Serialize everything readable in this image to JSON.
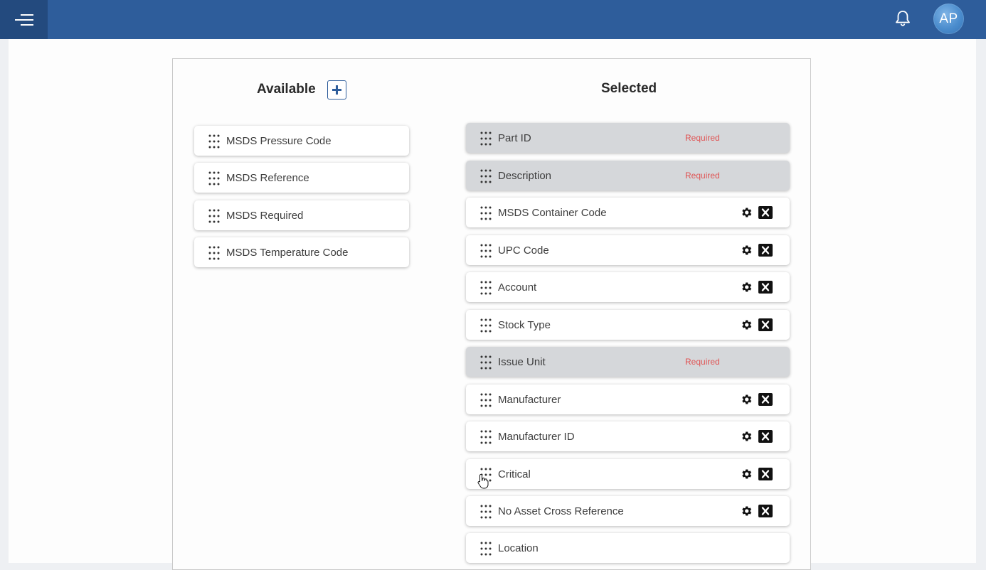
{
  "header": {
    "menu_icon": "hamburger-menu-icon",
    "notification_icon": "bell-icon",
    "avatar_initials": "AP",
    "bar_color": "#2e5d9b"
  },
  "available": {
    "title": "Available",
    "add_icon": "plus-icon",
    "items": [
      {
        "label": "MSDS Pressure Code"
      },
      {
        "label": "MSDS Reference"
      },
      {
        "label": "MSDS Required"
      },
      {
        "label": "MSDS Temperature Code"
      }
    ]
  },
  "selected": {
    "title": "Selected",
    "required_text": "Required",
    "required_color": "#e05252",
    "items": [
      {
        "label": "Part ID",
        "required": true
      },
      {
        "label": "Description",
        "required": true
      },
      {
        "label": "MSDS Container Code",
        "required": false
      },
      {
        "label": "UPC Code",
        "required": false
      },
      {
        "label": "Account",
        "required": false
      },
      {
        "label": "Stock Type",
        "required": false
      },
      {
        "label": "Issue Unit",
        "required": true
      },
      {
        "label": "Manufacturer",
        "required": false
      },
      {
        "label": "Manufacturer ID",
        "required": false
      },
      {
        "label": "Critical",
        "required": false
      },
      {
        "label": "No Asset Cross Reference",
        "required": false
      },
      {
        "label": "Location",
        "required": false
      }
    ]
  }
}
